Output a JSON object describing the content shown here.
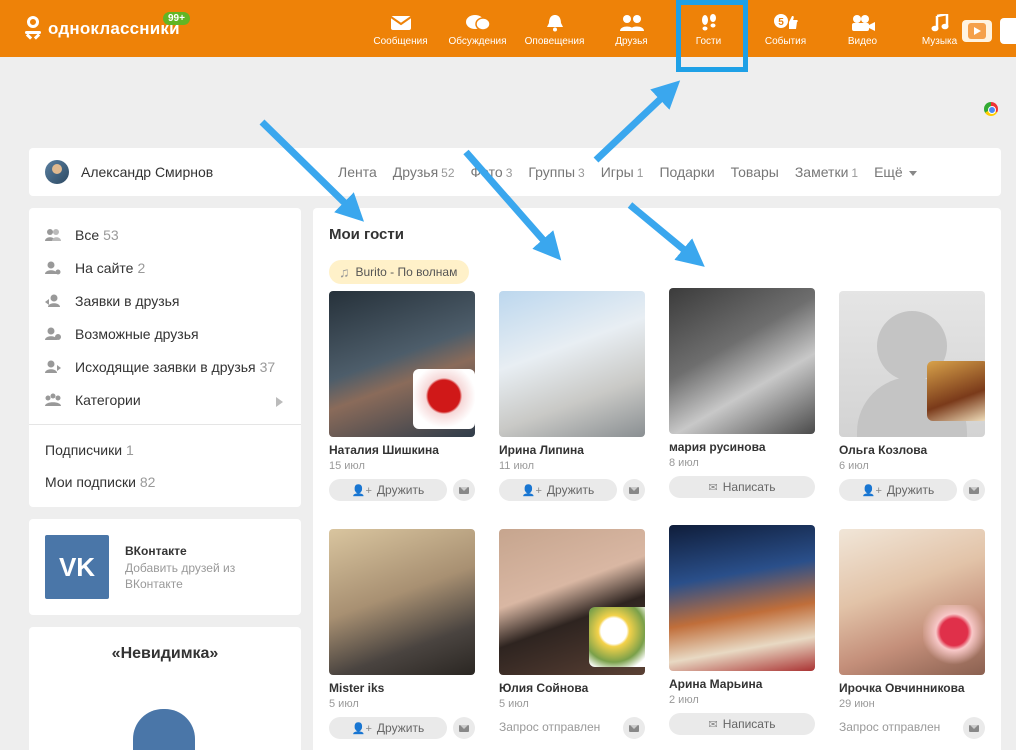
{
  "header": {
    "logo_text": "одноклассники",
    "logo_badge": "99+",
    "nav": [
      {
        "label": "Сообщения",
        "icon": "envelope-icon"
      },
      {
        "label": "Обсуждения",
        "icon": "chat-bubbles-icon"
      },
      {
        "label": "Оповещения",
        "icon": "bell-icon"
      },
      {
        "label": "Друзья",
        "icon": "people-icon"
      },
      {
        "label": "Гости",
        "icon": "footprints-icon"
      },
      {
        "label": "События",
        "icon": "thumbs-up-icon",
        "badge": "5"
      },
      {
        "label": "Видео",
        "icon": "video-camera-icon"
      },
      {
        "label": "Музыка",
        "icon": "music-note-icon"
      }
    ],
    "accent_color": "#ee8208",
    "highlight_color": "#1ea0e6"
  },
  "profile": {
    "name": "Александр Смирнов",
    "tabs": [
      {
        "label": "Лента",
        "count": ""
      },
      {
        "label": "Друзья",
        "count": "52"
      },
      {
        "label": "Фото",
        "count": "3"
      },
      {
        "label": "Группы",
        "count": "3"
      },
      {
        "label": "Игры",
        "count": "1"
      },
      {
        "label": "Подарки",
        "count": ""
      },
      {
        "label": "Товары",
        "count": ""
      },
      {
        "label": "Заметки",
        "count": "1"
      },
      {
        "label": "Ещё",
        "count": ""
      }
    ]
  },
  "sidebar": {
    "items": [
      {
        "label": "Все",
        "count": "53",
        "icon": "people-icon"
      },
      {
        "label": "На сайте",
        "count": "2",
        "icon": "user-online-icon"
      },
      {
        "label": "Заявки в друзья",
        "count": "",
        "icon": "user-incoming-icon"
      },
      {
        "label": "Возможные друзья",
        "count": "",
        "icon": "user-question-icon"
      },
      {
        "label": "Исходящие заявки в друзья",
        "count": "37",
        "icon": "user-outgoing-icon"
      },
      {
        "label": "Категории",
        "count": "",
        "icon": "groups-icon"
      }
    ],
    "subs": [
      {
        "label": "Подписчики",
        "count": "1"
      },
      {
        "label": "Мои подписки",
        "count": "82"
      }
    ]
  },
  "vk": {
    "logo": "VK",
    "title": "ВКонтакте",
    "desc": "Добавить друзей из ВКонтакте"
  },
  "invisible": {
    "title": "«Невидимка»"
  },
  "guests": {
    "title": "Мои гости",
    "music": "Burito - По волнам",
    "cards": [
      {
        "name": "Наталия Шишкина",
        "date": "15 июл",
        "action": "Дружить",
        "action_type": "button"
      },
      {
        "name": "Ирина Липина",
        "date": "11 июл",
        "action": "Дружить",
        "action_type": "button"
      },
      {
        "name": "мария русинова",
        "date": "8 июл",
        "action": "Написать",
        "action_type": "button"
      },
      {
        "name": "Ольга Козлова",
        "date": "6 июл",
        "action": "Дружить",
        "action_type": "button"
      },
      {
        "name": "Mister iks",
        "date": "5 июл",
        "action": "Дружить",
        "action_type": "button"
      },
      {
        "name": "Юлия Сойнова",
        "date": "5 июл",
        "action": "Запрос отправлен",
        "action_type": "text"
      },
      {
        "name": "Арина Марьина",
        "date": "2 июл",
        "action": "Написать",
        "action_type": "button"
      },
      {
        "name": "Ирочка Овчинникова",
        "date": "29 июн",
        "action": "Запрос отправлен",
        "action_type": "text"
      }
    ]
  },
  "annotation_arrows": {
    "color": "#3aa7ee",
    "count": 4
  }
}
